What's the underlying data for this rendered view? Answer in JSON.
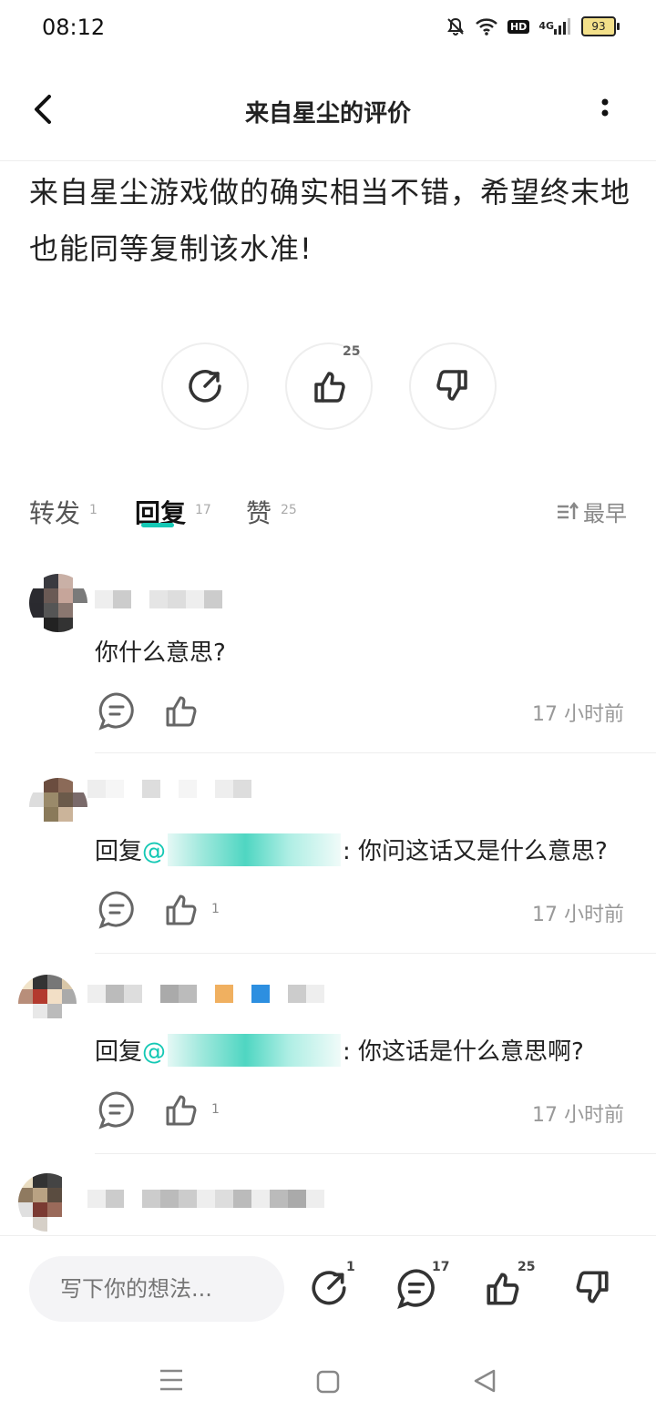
{
  "status_bar": {
    "time": "08:12",
    "battery": "93",
    "network": "4G",
    "hd": "HD"
  },
  "header": {
    "title": "来自星尘的评价"
  },
  "review": {
    "text": "来自星尘游戏做的确实相当不错，希望终末地也能同等复制该水准!",
    "like_count": "25"
  },
  "tabs": [
    {
      "label": "转发",
      "count": "1"
    },
    {
      "label": "回复",
      "count": "17",
      "active": true
    },
    {
      "label": "赞",
      "count": "25"
    }
  ],
  "sort": {
    "label": "最早"
  },
  "comments": [
    {
      "text": "你什么意思?",
      "likes": "",
      "time": "17 小时前"
    },
    {
      "reply_prefix": "回复",
      "mention": "@",
      "text": ": 你问这话又是什么意思?",
      "likes": "1",
      "time": "17 小时前"
    },
    {
      "reply_prefix": "回复",
      "mention": "@",
      "text": ": 你这话是什么意思啊?",
      "likes": "1",
      "time": "17 小时前"
    }
  ],
  "bottom_bar": {
    "placeholder": "写下你的想法...",
    "repost_count": "1",
    "comment_count": "17",
    "like_count": "25"
  },
  "colors": {
    "accent": "#14c8b4",
    "mention_link": "#14c8b4"
  }
}
